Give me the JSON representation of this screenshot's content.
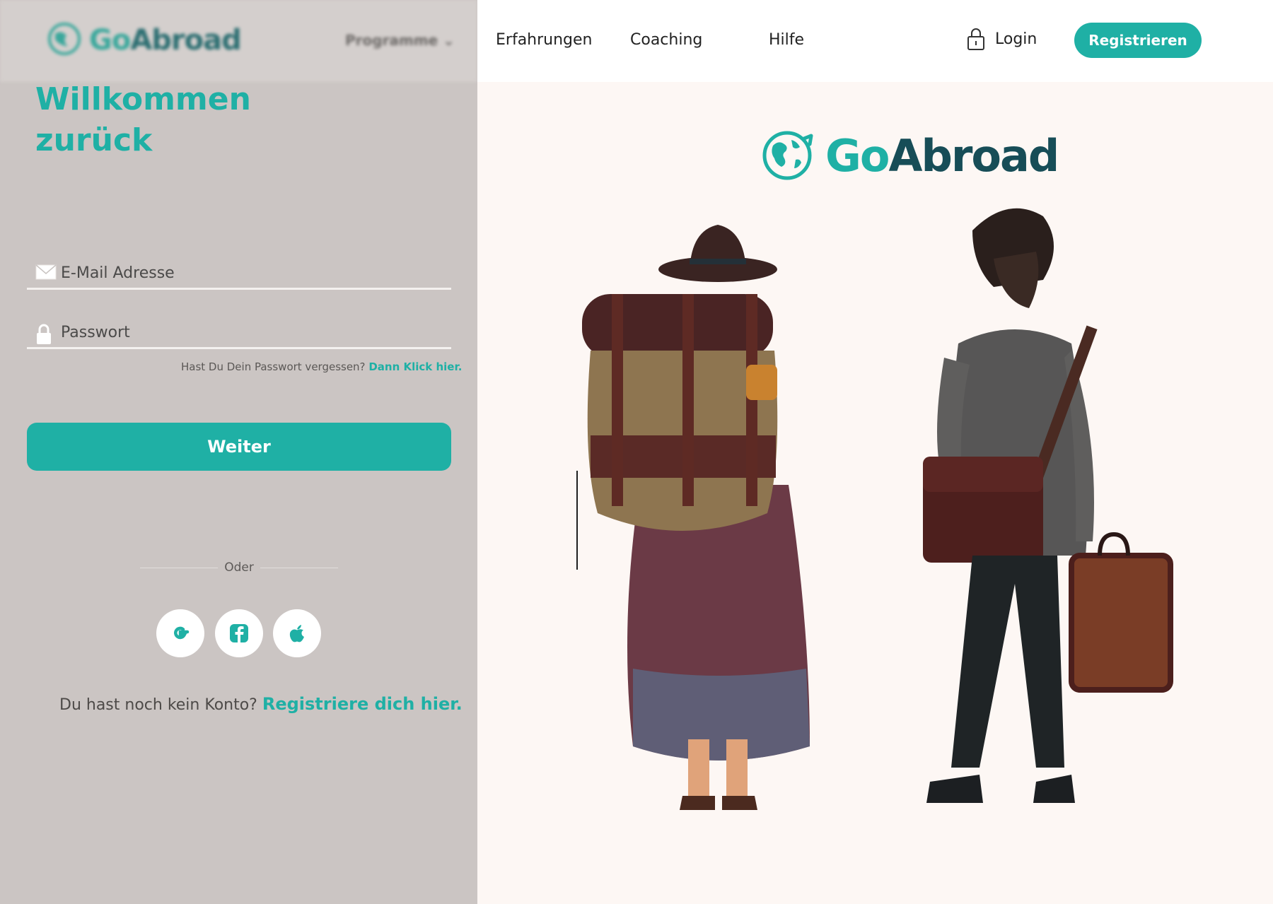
{
  "background_header": {
    "logo_part1": "Go",
    "logo_part2": "Abroad",
    "menu_label": "Programme ⌄"
  },
  "login_form": {
    "title_line1": "Willkommen",
    "title_line2": "zurück",
    "email_placeholder": "E-Mail Adresse",
    "password_placeholder": "Passwort",
    "forgot_text": "Hast Du Dein Passwort vergessen?",
    "forgot_link": "Dann Klick hier.",
    "submit_label": "Weiter",
    "divider_label": "Oder",
    "signup_text": "Du hast noch kein Konto?",
    "signup_link": "Registriere dich hier."
  },
  "nav": {
    "items": [
      "Erfahrungen",
      "Coaching",
      "Hilfe"
    ],
    "login_label": "Login",
    "register_label": "Registrieren"
  },
  "hero": {
    "brand_part1": "Go",
    "brand_part2": "Abroad"
  },
  "colors": {
    "accent": "#1fb0a5",
    "brand_dark": "#174d57",
    "panel_bg": "#cbc5c3",
    "hero_bg": "#fdf7f4"
  },
  "icons": {
    "email": "envelope-icon",
    "password": "lock-icon",
    "login": "lock-icon",
    "social": [
      "google-icon",
      "facebook-icon",
      "apple-icon"
    ],
    "brand": "globe-icon"
  }
}
